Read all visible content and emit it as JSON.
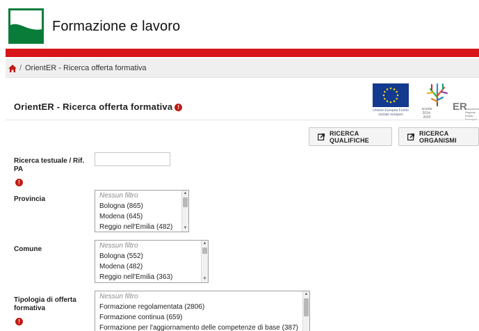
{
  "header": {
    "site_title": "Formazione e lavoro",
    "logo_icon": "regione-logo-icon"
  },
  "breadcrumb": {
    "separator": "/",
    "current": "OrientER - Ricerca offerta formativa",
    "home_icon": "home-icon"
  },
  "page": {
    "title": "OrientER - Ricerca offerta formativa",
    "info_icon": "!"
  },
  "logos": {
    "eu_caption": "Unione Europea Fondo sociale europeo",
    "er_left": "scuola 2014-2020",
    "er_right": "Educazione Regione Emilia-Romagna"
  },
  "buttons": {
    "qualifiche": "RICERCA QUALIFICHE",
    "organismi": "RICERCA ORGANISMI"
  },
  "form": {
    "testuale": {
      "label": "Ricerca testuale / Rif. PA",
      "value": "",
      "info_icon": "!"
    },
    "provincia": {
      "label": "Provincia",
      "options": [
        "Nessun filtro",
        "Bologna (865)",
        "Modena (645)",
        "Reggio nell'Emilia (482)"
      ]
    },
    "comune": {
      "label": "Comune",
      "options": [
        "Nessun filtro",
        "Bologna (552)",
        "Modena (482)",
        "Reggio nell'Emilia (363)"
      ]
    },
    "tipologia": {
      "label": "Tipologia di offerta formativa",
      "info_icon": "!",
      "options": [
        "Nessun filtro",
        "Formazione regolamentata (2806)",
        "Formazione continua (659)",
        "Formazione per l'aggiornamento delle competenze di base (387)"
      ]
    }
  },
  "colors": {
    "brand_green": "#0a7c3a",
    "accent_red": "#d7161a",
    "info_red": "#c01b12",
    "eu_blue": "#123a8f"
  }
}
